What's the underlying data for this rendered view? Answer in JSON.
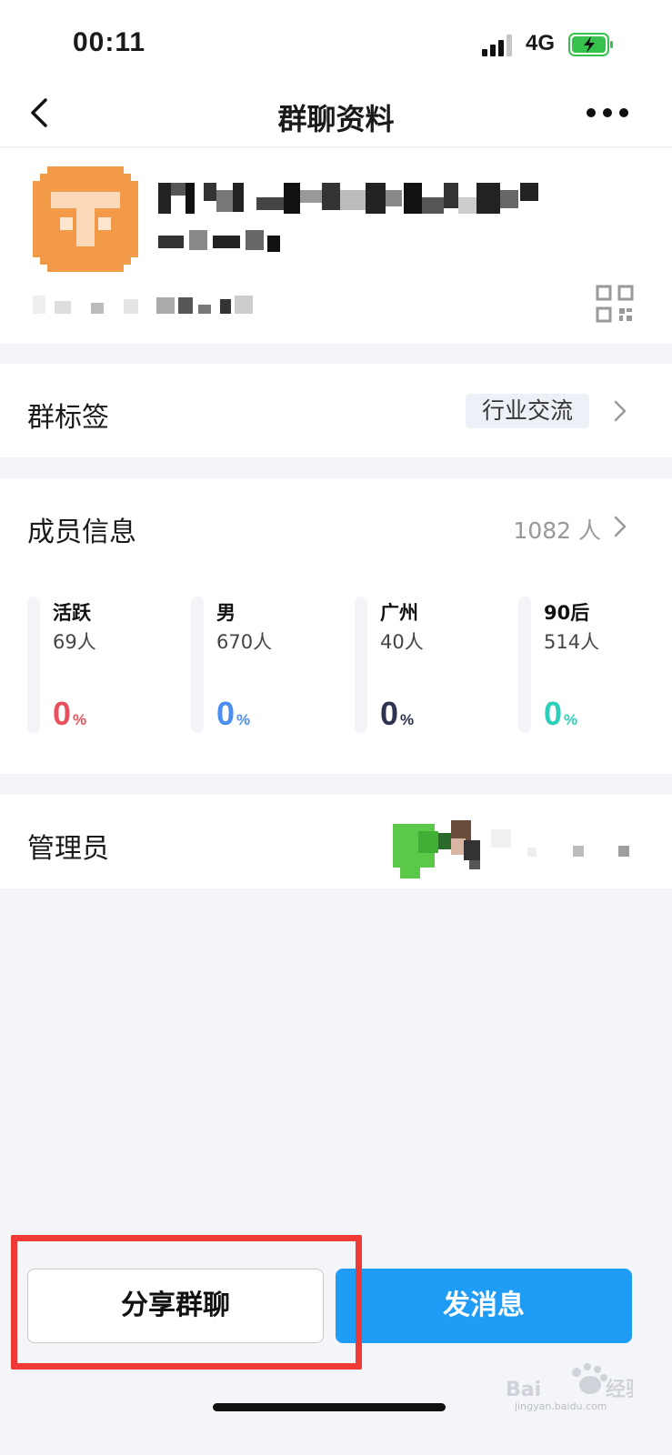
{
  "status_bar": {
    "time": "00:11",
    "network": "4G",
    "battery_color": "#37c24d"
  },
  "navbar": {
    "title": "群聊资料",
    "back_icon": "chevron-left-icon",
    "more_icon": "more-dots-icon"
  },
  "profile": {
    "avatar_color": "#f29a47",
    "qr_icon": "qr-code-icon"
  },
  "group_tag": {
    "label": "群标签",
    "tag": "行业交流"
  },
  "members": {
    "label": "成员信息",
    "count": "1082 人",
    "stats": [
      {
        "name": "活跃",
        "count": "69人",
        "percent": "0",
        "unit": "%",
        "color": "#e8505b"
      },
      {
        "name": "男",
        "count": "670人",
        "percent": "0",
        "unit": "%",
        "color": "#4a8ef0"
      },
      {
        "name": "广州",
        "count": "40人",
        "percent": "0",
        "unit": "%",
        "color": "#2d3350"
      },
      {
        "name": "90后",
        "count": "514人",
        "percent": "0",
        "unit": "%",
        "color": "#2ccfb9"
      }
    ]
  },
  "admins": {
    "label": "管理员"
  },
  "actions": {
    "share_label": "分享群聊",
    "send_label": "发消息",
    "send_color": "#1f9cf5",
    "highlight_color": "#ef3a36"
  },
  "watermark": {
    "brand": "Baidu经验",
    "url": "jingyan.baidu.com"
  }
}
